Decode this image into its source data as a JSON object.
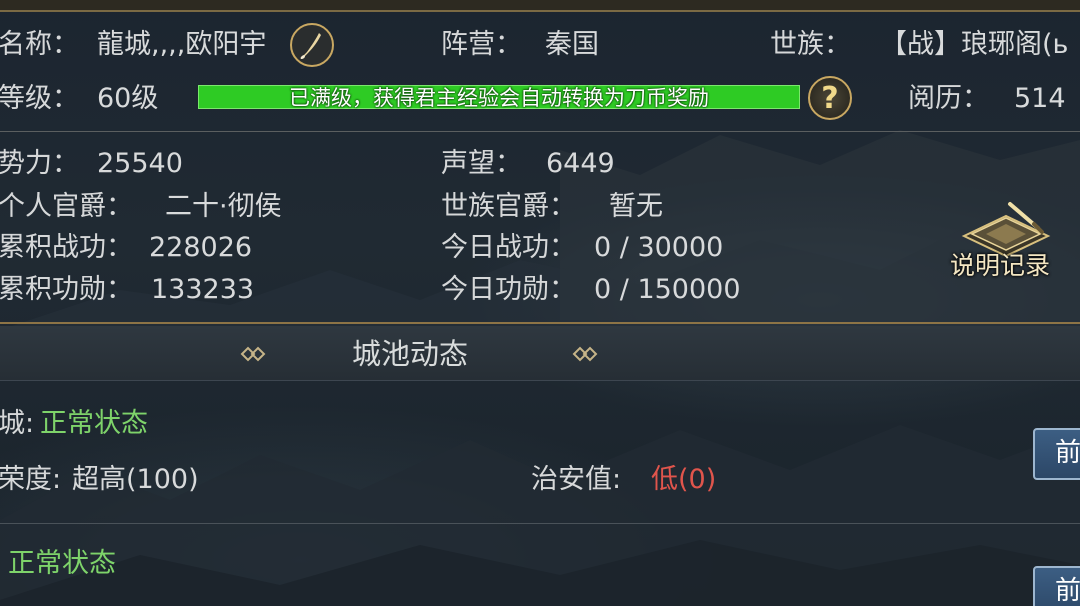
{
  "profile": {
    "name_label": "名称：",
    "name_value": "龍城,,,,欧阳宇",
    "camp_label": "阵营：",
    "camp_value": "秦国",
    "clan_label": "世族：",
    "clan_value": "【战】琅琊阁(ь",
    "level_label": "等级：",
    "level_value": "60级",
    "exp_message": "已满级，获得君主经验会自动转换为刀币奖励",
    "help_glyph": "?",
    "experience_label": "阅历：",
    "experience_value": "514"
  },
  "stats": {
    "power_label": "势力：",
    "power_value": "25540",
    "prestige_label": "声望：",
    "prestige_value": "6449",
    "personal_rank_label": "个人官爵：",
    "personal_rank_value": "二十·彻侯",
    "clan_rank_label": "世族官爵：",
    "clan_rank_value": "暂无",
    "total_merit_label": "累积战功：",
    "total_merit_value": "228026",
    "today_merit_label": "今日战功：",
    "today_merit_value": "0 / 30000",
    "total_honor_label": "累积功勋：",
    "total_honor_value": "133233",
    "today_honor_label": "今日功勋：",
    "today_honor_value": "0 / 150000",
    "records_label": "说明记录"
  },
  "city_section": {
    "title": "城池动态",
    "city1": {
      "state_label": "城:",
      "state_value": "正常状态",
      "prosperity_label": "荣度:",
      "prosperity_value": "超高(100)",
      "security_label": "治安值:",
      "security_value": "低(0)",
      "goto_label": "前"
    },
    "city2": {
      "state_value": "正常状态",
      "goto_label": "前"
    }
  },
  "colors": {
    "exp_bar": "#2ecb24",
    "good_status": "#7ed36a",
    "bad_status": "#e0554c",
    "gold_accent": "#c9a862"
  }
}
